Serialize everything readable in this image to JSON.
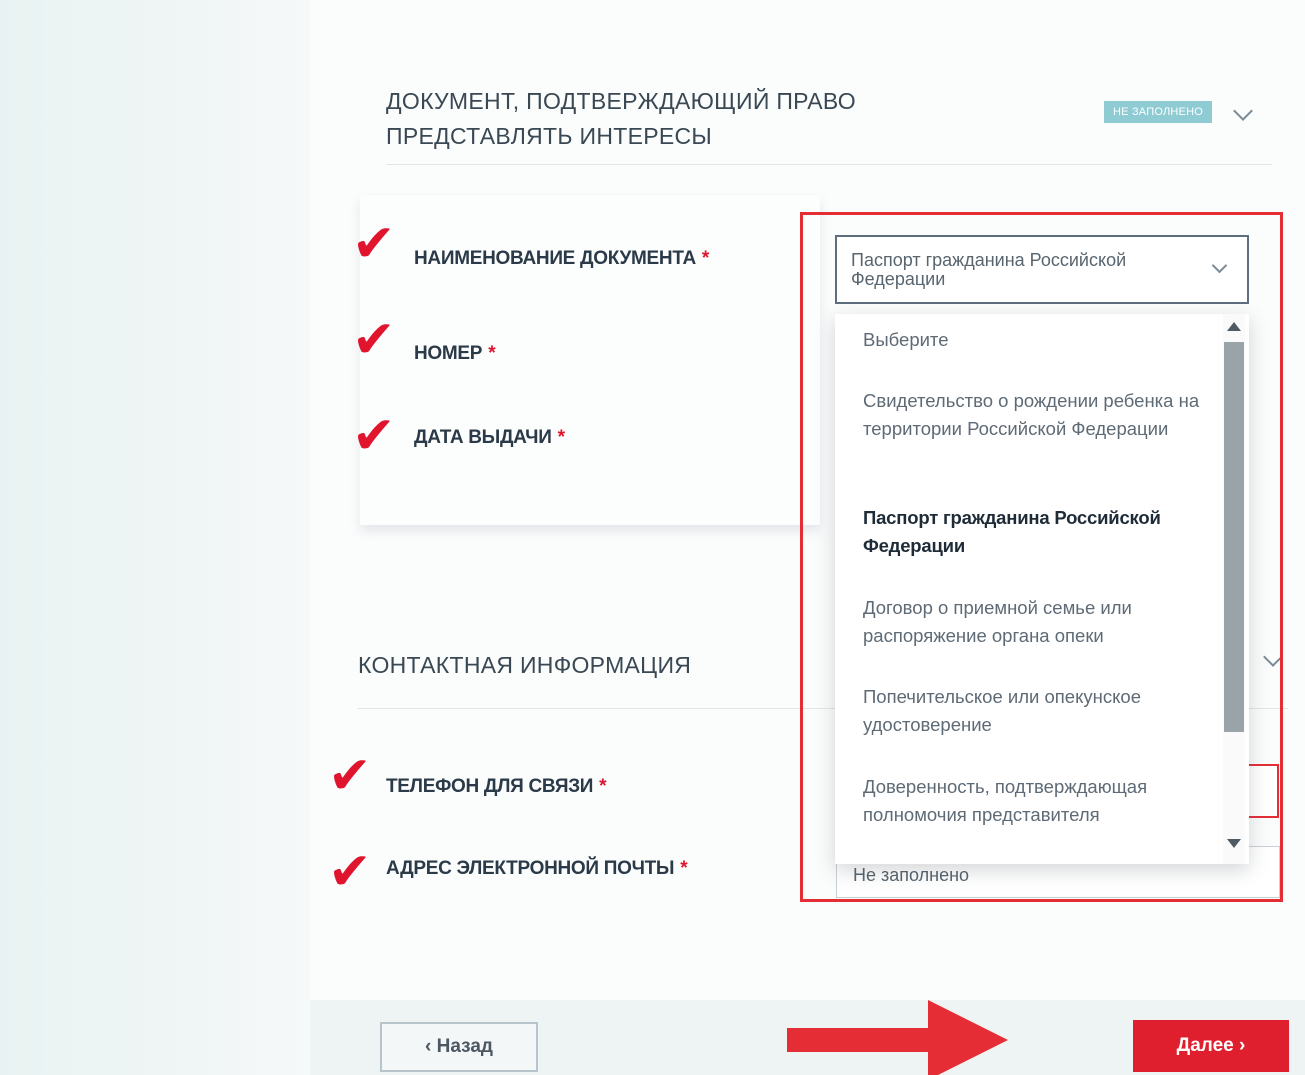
{
  "document_section": {
    "title_line1": "ДОКУМЕНТ, ПОДТВЕРЖДАЮЩИЙ ПРАВО",
    "title_line2": "ПРЕДСТАВЛЯТЬ ИНТЕРЕСЫ",
    "status_badge": "НЕ ЗАПОЛНЕНО",
    "fields": {
      "doc_name_label": "НАИМЕНОВАНИЕ ДОКУМЕНТА",
      "number_label": "НОМЕР",
      "issue_date_label": "ДАТА ВЫДАЧИ",
      "required_mark": "*"
    },
    "select": {
      "value": "Паспорт гражданина Российской Федерации",
      "options": [
        "Выберите",
        "Свидетельство о рождении ребенка на территории Российской Федерации",
        "Паспорт гражданина Российской Федерации",
        "Договор о приемной семье или распоряжение органа опеки",
        "Попечительское или опекунское удостоверение",
        "Доверенность, подтверждающая полномочия представителя"
      ],
      "selected_index": 2
    }
  },
  "contact_section": {
    "title": "КОНТАКТНАЯ ИНФОРМАЦИЯ",
    "phone_label": "ТЕЛЕФОН ДЛЯ СВЯЗИ",
    "email_label": "АДРЕС ЭЛЕКТРОННОЙ ПОЧТЫ",
    "email_value": "Не заполнено"
  },
  "annotation": {
    "check_glyph": "✔",
    "highlight_color": "#e52d36"
  },
  "footer": {
    "back_label": "‹ Назад",
    "next_label": "Далее ›"
  },
  "colors": {
    "accent_red": "#e01f2e",
    "badge_bg": "#8fcbd3"
  }
}
